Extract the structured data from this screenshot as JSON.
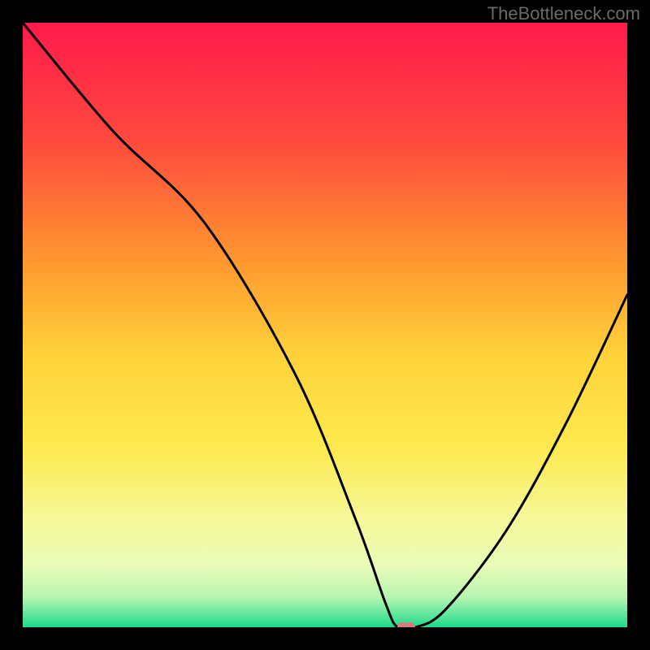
{
  "watermark": "TheBottleneck.com",
  "chart_data": {
    "type": "line",
    "title": "",
    "xlabel": "",
    "ylabel": "",
    "xlim": [
      0,
      100
    ],
    "ylim": [
      0,
      100
    ],
    "series": [
      {
        "name": "bottleneck-curve",
        "x": [
          0,
          15,
          30,
          45,
          55,
          60,
          62,
          65,
          70,
          80,
          90,
          100
        ],
        "values": [
          100,
          82,
          67,
          42,
          18,
          4,
          0,
          0,
          3,
          16,
          34,
          55
        ]
      }
    ],
    "marker": {
      "x": 63.5,
      "y": 0
    },
    "gradient_stops": [
      {
        "offset": 0.0,
        "color": "#ff1a4b"
      },
      {
        "offset": 0.2,
        "color": "#ff4b3e"
      },
      {
        "offset": 0.4,
        "color": "#ff9a2f"
      },
      {
        "offset": 0.55,
        "color": "#ffd23a"
      },
      {
        "offset": 0.7,
        "color": "#fde94e"
      },
      {
        "offset": 0.82,
        "color": "#f6f898"
      },
      {
        "offset": 0.9,
        "color": "#e9fcb8"
      },
      {
        "offset": 0.95,
        "color": "#b6f5b0"
      },
      {
        "offset": 0.975,
        "color": "#6de8a0"
      },
      {
        "offset": 1.0,
        "color": "#1fd98a"
      }
    ]
  }
}
